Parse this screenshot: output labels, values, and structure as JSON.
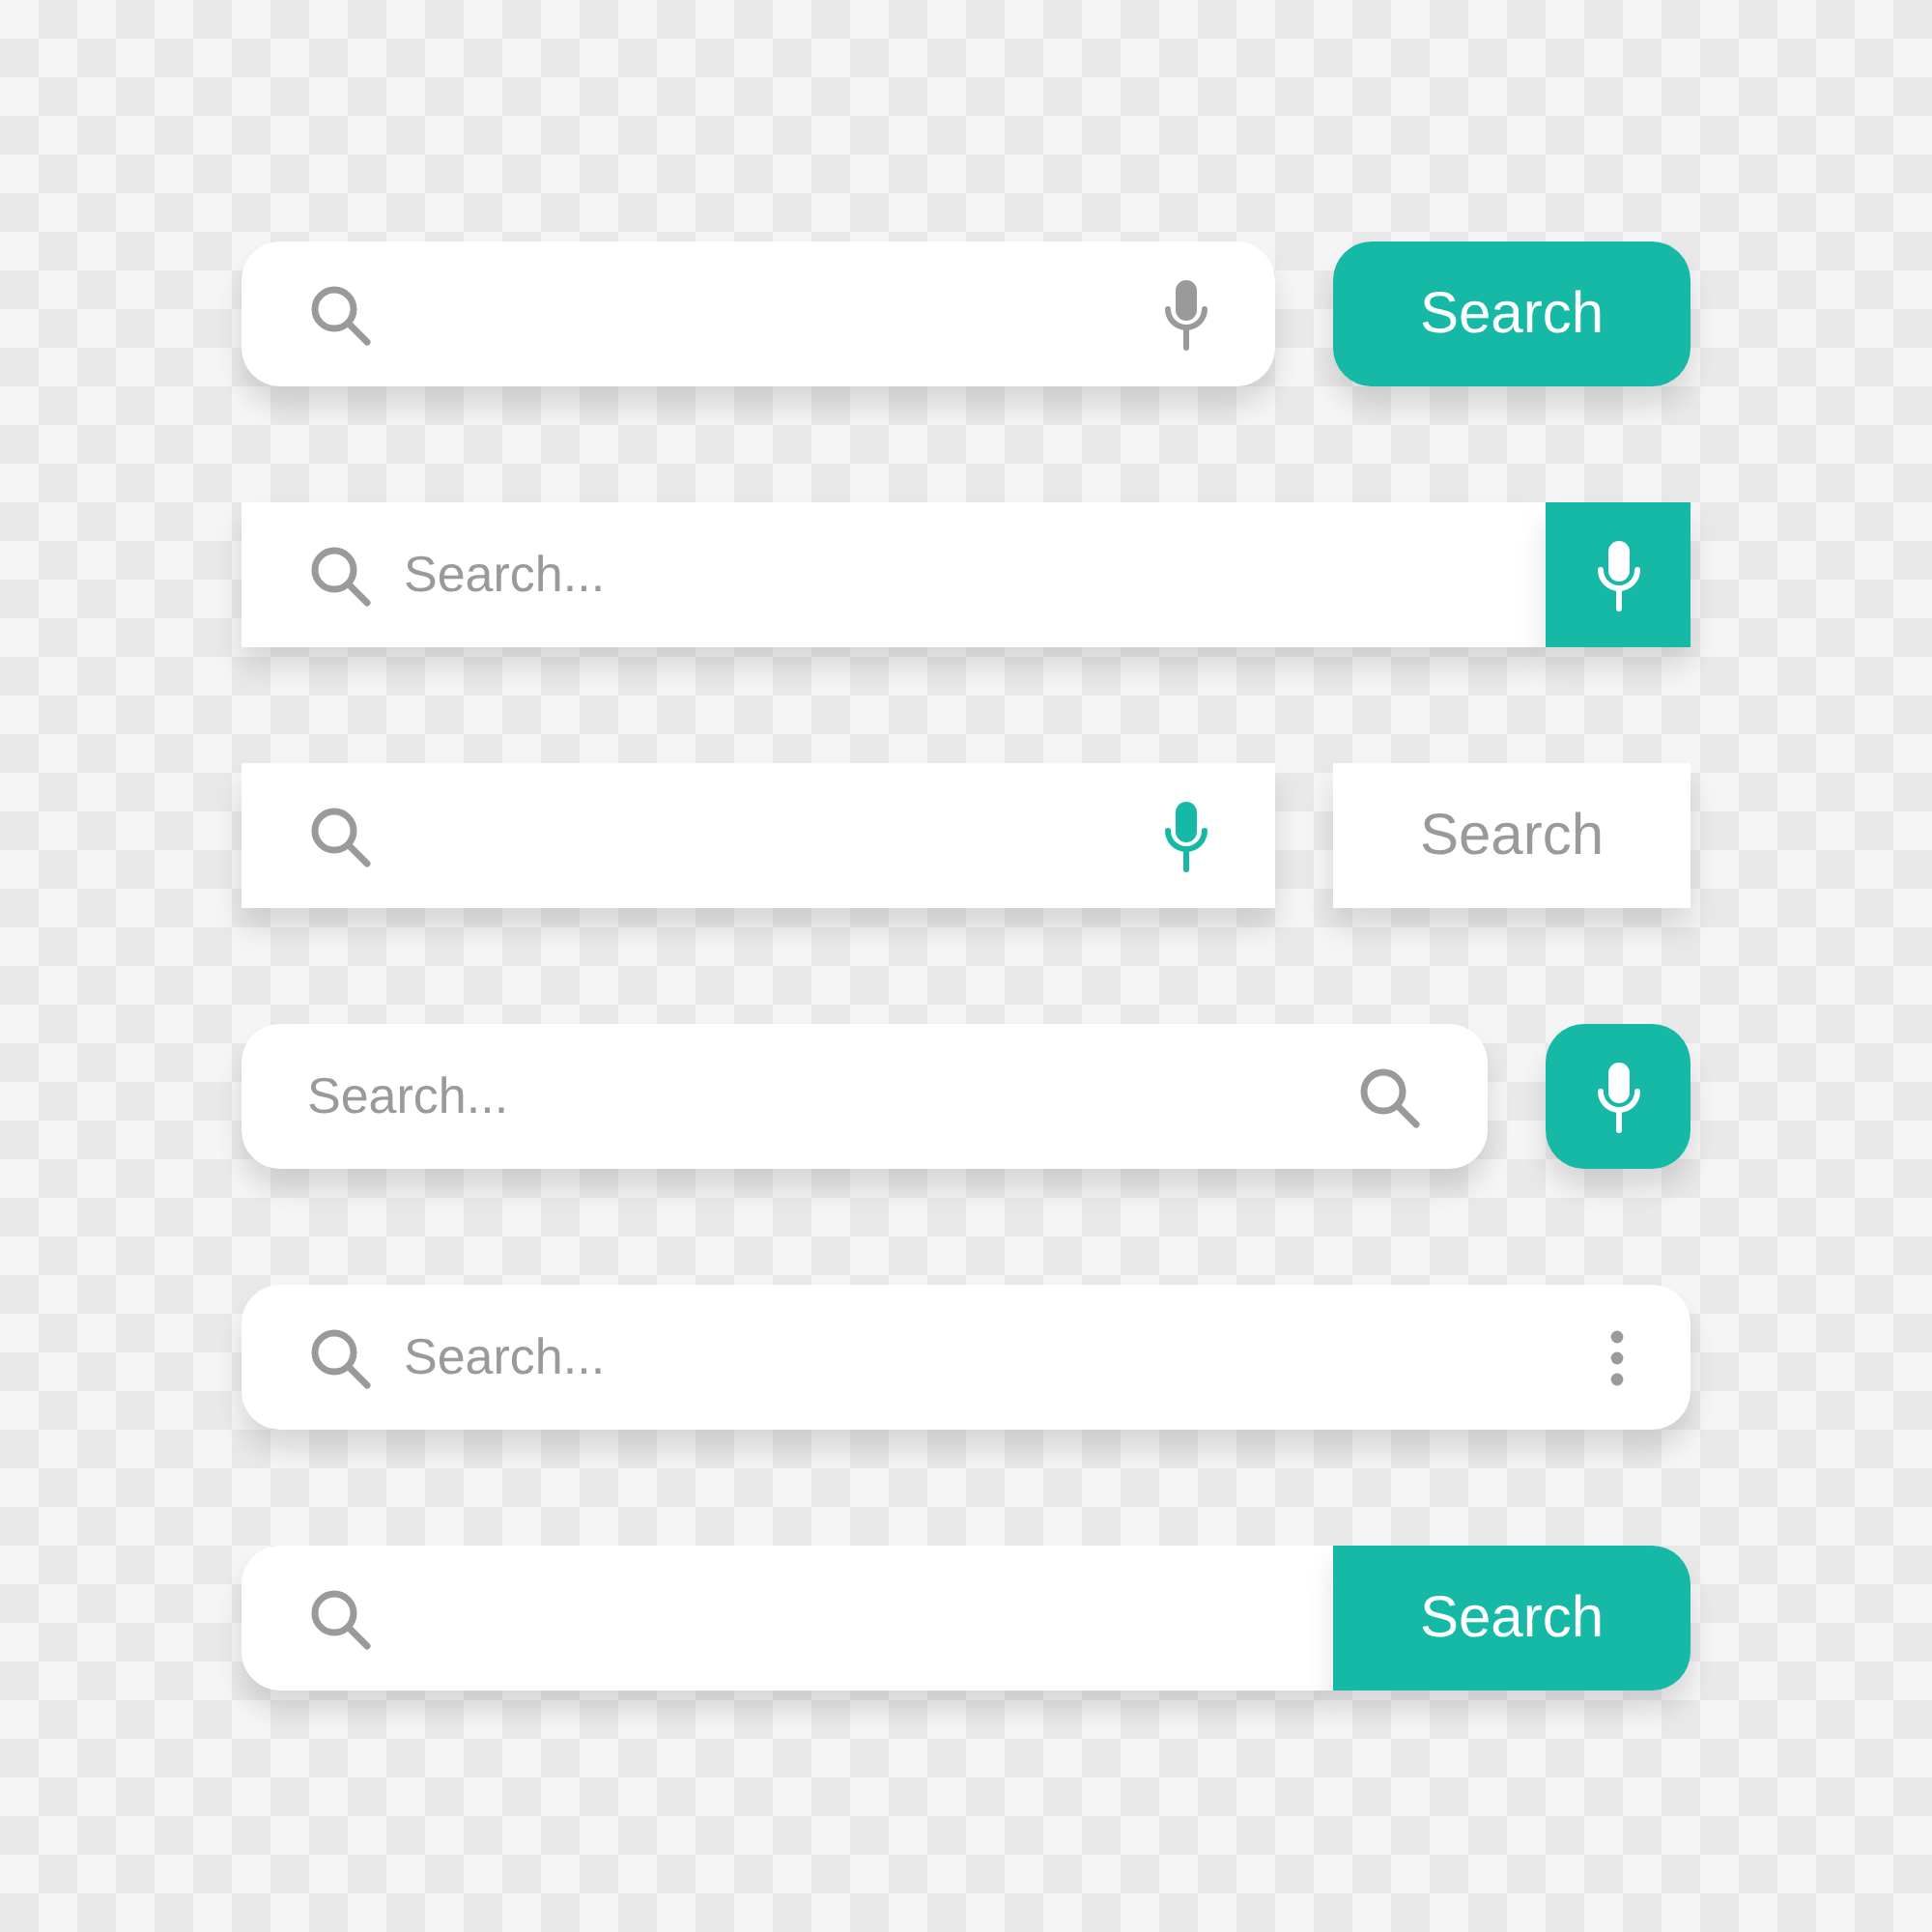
{
  "search_bars": [
    {
      "kind": "field-and-button",
      "button": "Search"
    },
    {
      "kind": "field-with-mic",
      "placeholder": "Search..."
    },
    {
      "kind": "field-and-plain-button",
      "button": "Search"
    },
    {
      "kind": "field-and-mic-button",
      "placeholder": "Search..."
    },
    {
      "kind": "field-with-menu",
      "placeholder": "Search..."
    },
    {
      "kind": "field-with-attached-button",
      "button": "Search"
    }
  ]
}
